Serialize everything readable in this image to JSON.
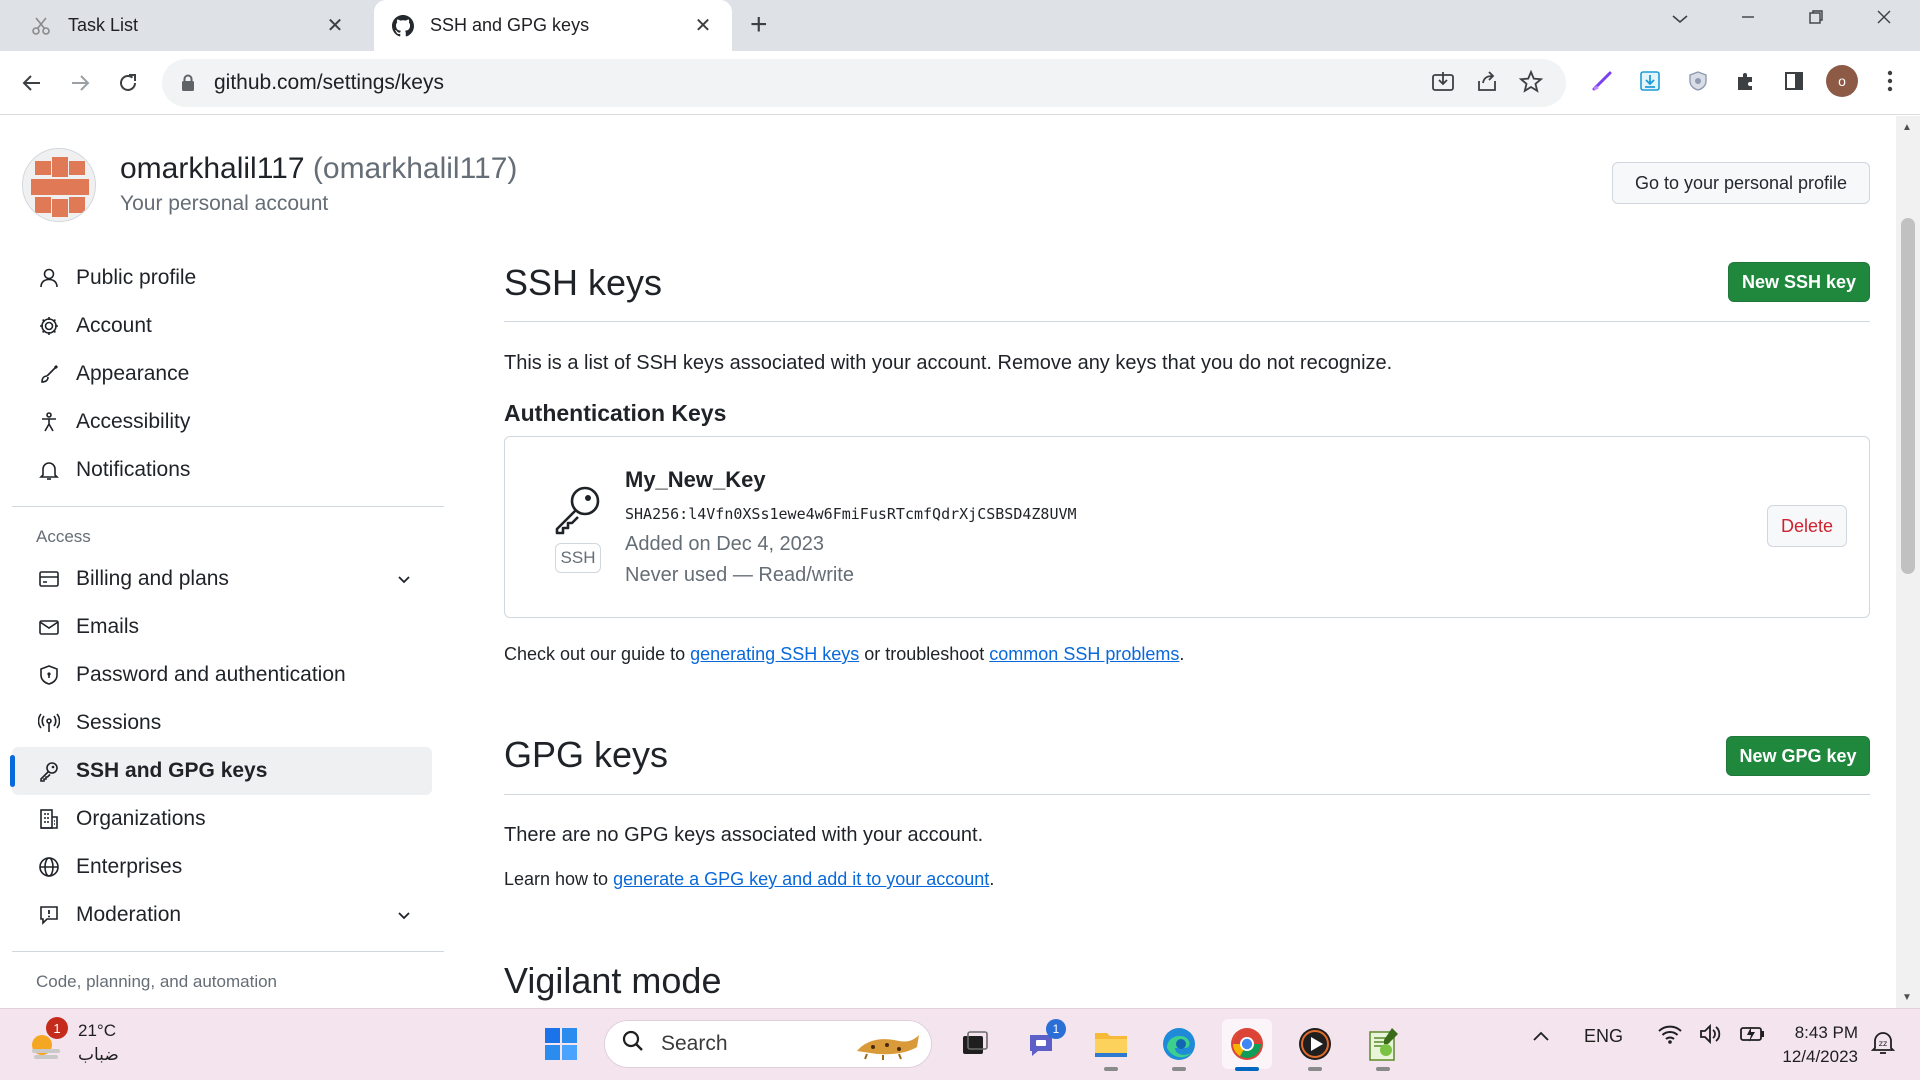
{
  "browser": {
    "tabs": [
      {
        "title": "Task List",
        "active": false
      },
      {
        "title": "SSH and GPG keys",
        "active": true
      }
    ],
    "url": "github.com/settings/keys",
    "profile_initial": "o"
  },
  "header": {
    "username": "omarkhalil117",
    "login": "(omarkhalil117)",
    "subtitle": "Your personal account",
    "go_profile_label": "Go to your personal profile"
  },
  "sidebar": {
    "items": [
      {
        "label": "Public profile",
        "icon": "person-icon"
      },
      {
        "label": "Account",
        "icon": "gear-icon"
      },
      {
        "label": "Appearance",
        "icon": "paintbrush-icon"
      },
      {
        "label": "Accessibility",
        "icon": "accessibility-icon"
      },
      {
        "label": "Notifications",
        "icon": "bell-icon"
      }
    ],
    "access_heading": "Access",
    "access_items": [
      {
        "label": "Billing and plans",
        "icon": "credit-card-icon",
        "expandable": true
      },
      {
        "label": "Emails",
        "icon": "mail-icon"
      },
      {
        "label": "Password and authentication",
        "icon": "shield-icon"
      },
      {
        "label": "Sessions",
        "icon": "broadcast-icon"
      },
      {
        "label": "SSH and GPG keys",
        "icon": "key-icon",
        "active": true
      },
      {
        "label": "Organizations",
        "icon": "organization-icon"
      },
      {
        "label": "Enterprises",
        "icon": "globe-icon"
      },
      {
        "label": "Moderation",
        "icon": "report-icon",
        "expandable": true
      }
    ],
    "code_heading": "Code, planning, and automation"
  },
  "ssh": {
    "title": "SSH keys",
    "new_button": "New SSH key",
    "description": "This is a list of SSH keys associated with your account. Remove any keys that you do not recognize.",
    "auth_heading": "Authentication Keys",
    "key": {
      "name": "My_New_Key",
      "type": "SSH",
      "fingerprint": "SHA256:l4Vfn0XSs1ewe4w6FmiFusRTcmfQdrXjCSBSD4Z8UVM",
      "added": "Added on Dec 4, 2023",
      "usage": "Never used — Read/write",
      "delete_label": "Delete"
    },
    "guide_prefix": "Check out our guide to ",
    "guide_link1": "generating SSH keys",
    "guide_mid": " or troubleshoot ",
    "guide_link2": "common SSH problems",
    "guide_suffix": "."
  },
  "gpg": {
    "title": "GPG keys",
    "new_button": "New GPG key",
    "description": "There are no GPG keys associated with your account.",
    "learn_prefix": "Learn how to ",
    "learn_link": "generate a GPG key and add it to your account",
    "learn_suffix": "."
  },
  "vigilant": {
    "title": "Vigilant mode"
  },
  "taskbar": {
    "weather_temp": "21°C",
    "weather_desc": "ضباب",
    "weather_badge": "1",
    "search_placeholder": "Search",
    "teams_badge": "1",
    "language": "ENG",
    "time": "8:43 PM",
    "date": "12/4/2023"
  },
  "colors": {
    "accent": "#0969da",
    "primary_button": "#1f883d",
    "danger": "#cf222e",
    "avatar_identicon": "#e07a56"
  }
}
